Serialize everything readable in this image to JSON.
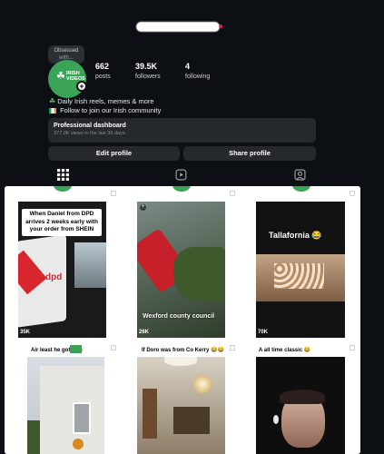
{
  "header": {
    "username_redacted": true
  },
  "profile": {
    "note": {
      "line1": "Obsessed",
      "line2": "with..."
    },
    "avatar_text": "IRISH VIDEOS",
    "stats": [
      {
        "value": "662",
        "label": "posts"
      },
      {
        "value": "39.5K",
        "label": "followers"
      },
      {
        "value": "4",
        "label": "following"
      }
    ],
    "bio": [
      {
        "icon": "shamrock",
        "text": "Daily Irish reels, memes & more"
      },
      {
        "icon": "irish-flag",
        "text": "Follow to join our Irish community"
      }
    ]
  },
  "dashboard": {
    "title": "Professional dashboard",
    "subtitle": "377.0K views in the last 30 days."
  },
  "buttons": {
    "edit": "Edit profile",
    "share": "Share profile"
  },
  "tabs": [
    "grid-icon",
    "reels-icon",
    "tagged-icon"
  ],
  "posts": [
    {
      "caption": "When Daniel from DPD arrives 2 weeks early with your order from SHEIN",
      "brand": "dpd",
      "views": "35K"
    },
    {
      "caption": "",
      "overlay": "Wexford county council",
      "views": "26K"
    },
    {
      "caption": "Tallafornia 😂",
      "views": "70K"
    },
    {
      "caption": "Air least he got it 😂"
    },
    {
      "caption": "If Doro was from Co Kerry 😂😂"
    },
    {
      "caption": "A all time classic 😂"
    }
  ],
  "colors": {
    "background": "#0c1014",
    "card": "#25292e",
    "accent_green": "#3aa356"
  }
}
